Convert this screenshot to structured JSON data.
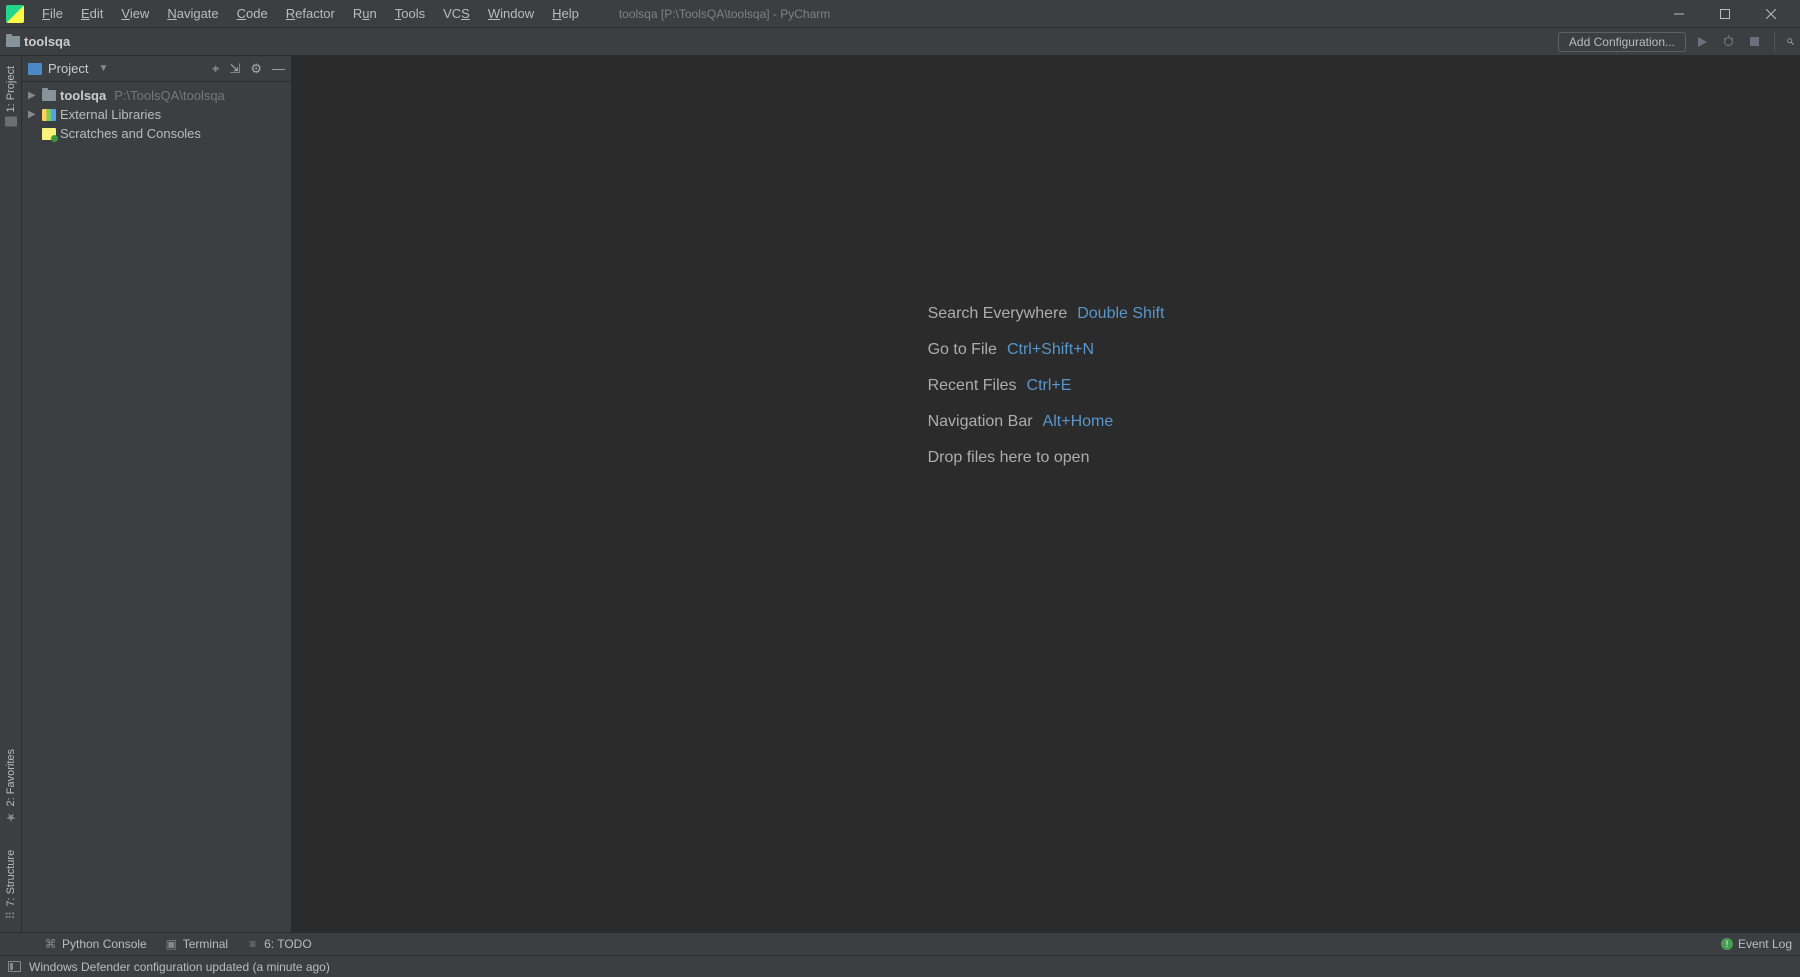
{
  "menu": {
    "items": [
      "File",
      "Edit",
      "View",
      "Navigate",
      "Code",
      "Refactor",
      "Run",
      "Tools",
      "VCS",
      "Window",
      "Help"
    ]
  },
  "window_title": "toolsqa [P:\\ToolsQA\\toolsqa] - PyCharm",
  "breadcrumb": {
    "root": "toolsqa"
  },
  "toolbar": {
    "add_configuration": "Add Configuration..."
  },
  "project_panel": {
    "title": "Project",
    "tree": {
      "project_name": "toolsqa",
      "project_path": "P:\\ToolsQA\\toolsqa",
      "external_libs": "External Libraries",
      "scratches": "Scratches and Consoles"
    }
  },
  "left_gutter": {
    "project": "1: Project",
    "favorites": "2: Favorites",
    "structure": "7: Structure"
  },
  "editor_hints": [
    {
      "label": "Search Everywhere",
      "key": "Double Shift"
    },
    {
      "label": "Go to File",
      "key": "Ctrl+Shift+N"
    },
    {
      "label": "Recent Files",
      "key": "Ctrl+E"
    },
    {
      "label": "Navigation Bar",
      "key": "Alt+Home"
    },
    {
      "label": "Drop files here to open",
      "key": ""
    }
  ],
  "bottom_tools": {
    "python_console": "Python Console",
    "terminal": "Terminal",
    "todo": "6: TODO",
    "event_log": "Event Log"
  },
  "status_message": "Windows Defender configuration updated (a minute ago)"
}
